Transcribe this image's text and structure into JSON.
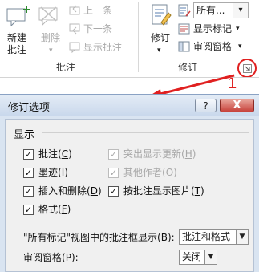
{
  "ribbon": {
    "new_comment": "新建\n批注",
    "delete": "删除",
    "prev": "上一条",
    "next": "下一条",
    "show_comments": "显示批注",
    "comments_group": "批注",
    "track_changes": "修订",
    "markup_select": "所有...",
    "show_markup": "显示标记",
    "reviewing_pane": "审阅窗格",
    "tracking_group": "修订",
    "annotation_number": "1"
  },
  "dialog": {
    "title": "修订选项",
    "help": "?",
    "close": "X",
    "section_show": "显示",
    "checkboxes": [
      {
        "label": "批注",
        "key": "C",
        "checked": true,
        "enabled": true
      },
      {
        "label": "墨迹",
        "key": "I",
        "checked": true,
        "enabled": true
      },
      {
        "label": "插入和删除",
        "key": "D",
        "checked": true,
        "enabled": true
      },
      {
        "label": "格式",
        "key": "F",
        "checked": true,
        "enabled": true
      },
      {
        "label": "突出显示更新",
        "key": "H",
        "checked": true,
        "enabled": false
      },
      {
        "label": "其他作者",
        "key": "O",
        "checked": true,
        "enabled": false
      },
      {
        "label": "按批注显示图片",
        "key": "T",
        "checked": true,
        "enabled": true
      }
    ],
    "balloon_label": "\"所有标记\"视图中的批注框显示(",
    "balloon_key": "B",
    "balloon_value": "批注和格式",
    "pane_label": "审阅窗格(",
    "pane_key": "P",
    "pane_value": "关闭"
  }
}
